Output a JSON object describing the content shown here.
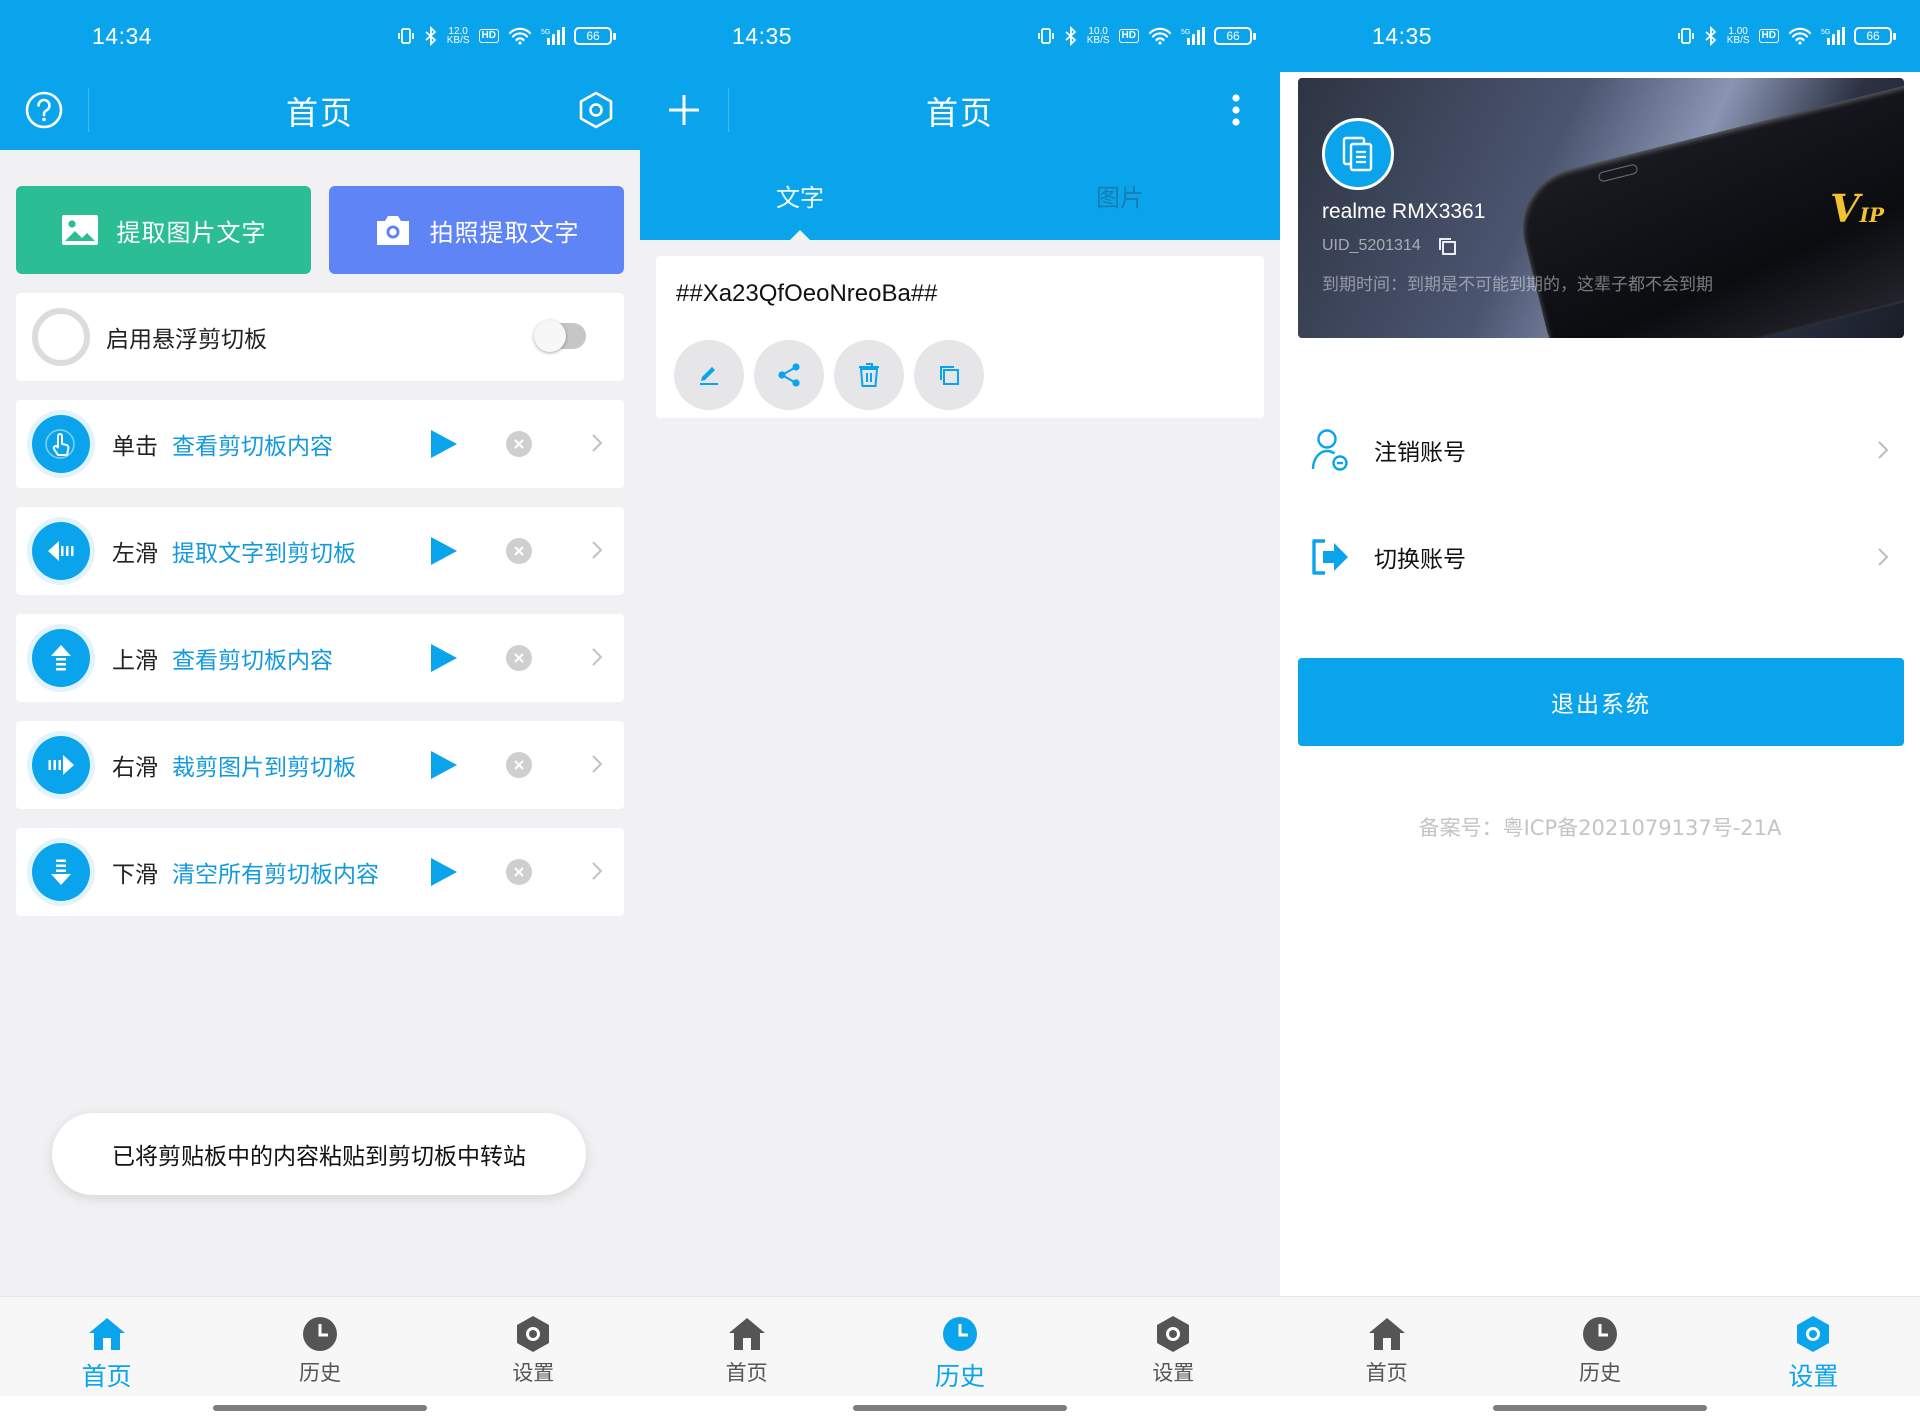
{
  "screens": [
    {
      "status": {
        "time": "14:34",
        "speed_value": "12.0",
        "speed_unit": "KB/S",
        "hd": "HD",
        "battery": "66"
      },
      "toolbar": {
        "title": "首页"
      },
      "buttons": {
        "extract_image": "提取图片文字",
        "photo_extract": "拍照提取文字"
      },
      "floating_clipboard": {
        "label": "启用悬浮剪切板",
        "enabled": false
      },
      "gestures": [
        {
          "name": "单击",
          "action": "查看剪切板内容",
          "icon": "tap-icon"
        },
        {
          "name": "左滑",
          "action": "提取文字到剪切板",
          "icon": "arrow-left-icon"
        },
        {
          "name": "上滑",
          "action": "查看剪切板内容",
          "icon": "arrow-up-icon"
        },
        {
          "name": "右滑",
          "action": "裁剪图片到剪切板",
          "icon": "arrow-right-icon"
        },
        {
          "name": "下滑",
          "action": "清空所有剪切板内容",
          "icon": "arrow-down-icon"
        }
      ],
      "toast": "已将剪贴板中的内容粘贴到剪切板中转站",
      "nav": {
        "home": "首页",
        "history": "历史",
        "settings": "设置",
        "active": "home"
      }
    },
    {
      "status": {
        "time": "14:35",
        "speed_value": "10.0",
        "speed_unit": "KB/S",
        "hd": "HD",
        "battery": "66"
      },
      "toolbar": {
        "title": "首页"
      },
      "tabs": {
        "text": "文字",
        "image": "图片",
        "active": "text"
      },
      "note": {
        "content": "##Xa23QfOeoNreoBa##"
      },
      "nav": {
        "home": "首页",
        "history": "历史",
        "settings": "设置",
        "active": "history"
      }
    },
    {
      "status": {
        "time": "14:35",
        "speed_value": "1.00",
        "speed_unit": "KB/S",
        "hd": "HD",
        "battery": "66"
      },
      "account": {
        "device": "realme RMX3361",
        "uid": "UID_5201314",
        "expire": "到期时间：到期是不可能到期的，这辈子都不会到期",
        "vip": "V",
        "vip_suffix": "IP"
      },
      "menu": {
        "cancel_account": "注销账号",
        "switch_account": "切换账号"
      },
      "logout": "退出系统",
      "icp": "备案号：粤ICP备2021079137号-21A",
      "nav": {
        "home": "首页",
        "history": "历史",
        "settings": "设置",
        "active": "settings"
      }
    }
  ],
  "colors": {
    "primary": "#0aa4ec",
    "green": "#2bbd94",
    "indigo": "#5f84f5",
    "vip_gold": "#f2c230"
  }
}
